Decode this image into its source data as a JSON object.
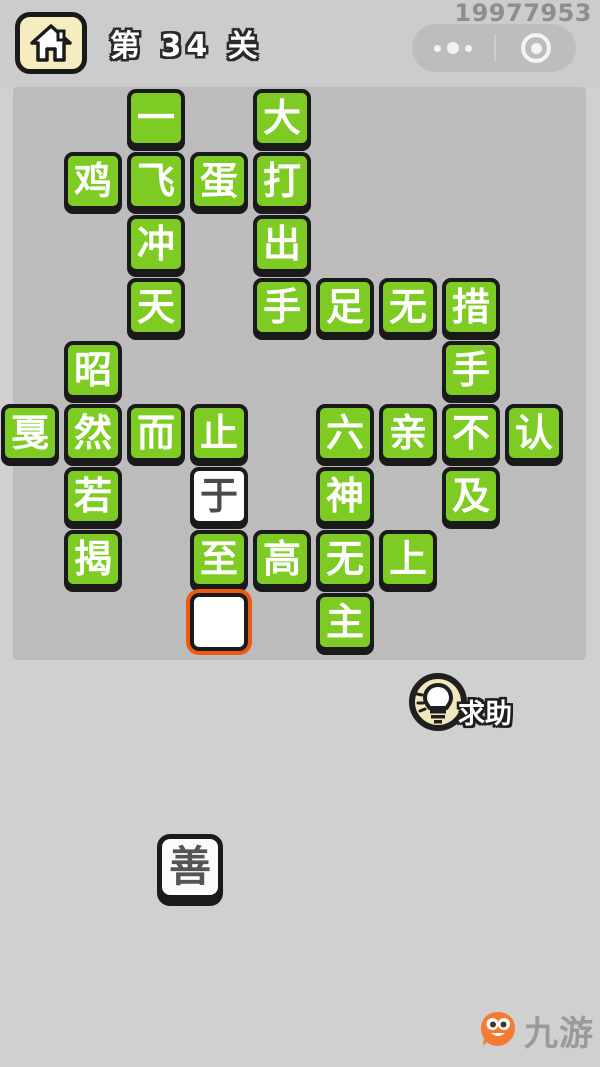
{
  "header": {
    "home_icon": "home-icon",
    "level_text": "第 34 关",
    "score": "19977953",
    "capsule": {
      "menu_icon": "more-dots-icon",
      "target_icon": "target-circle-icon"
    }
  },
  "board": {
    "columns": 8,
    "rows": 9,
    "tiles": [
      {
        "text": "一",
        "col": 1,
        "row": 0,
        "state": "filled"
      },
      {
        "text": "大",
        "col": 3,
        "row": 0,
        "state": "filled"
      },
      {
        "text": "鸡",
        "col": 0,
        "row": 1,
        "state": "filled"
      },
      {
        "text": "飞",
        "col": 1,
        "row": 1,
        "state": "filled"
      },
      {
        "text": "蛋",
        "col": 2,
        "row": 1,
        "state": "filled"
      },
      {
        "text": "打",
        "col": 3,
        "row": 1,
        "state": "filled"
      },
      {
        "text": "冲",
        "col": 1,
        "row": 2,
        "state": "filled"
      },
      {
        "text": "出",
        "col": 3,
        "row": 2,
        "state": "filled"
      },
      {
        "text": "天",
        "col": 1,
        "row": 3,
        "state": "filled"
      },
      {
        "text": "手",
        "col": 3,
        "row": 3,
        "state": "filled"
      },
      {
        "text": "足",
        "col": 4,
        "row": 3,
        "state": "filled"
      },
      {
        "text": "无",
        "col": 5,
        "row": 3,
        "state": "filled"
      },
      {
        "text": "措",
        "col": 6,
        "row": 3,
        "state": "filled"
      },
      {
        "text": "昭",
        "col": 0,
        "row": 4,
        "state": "filled"
      },
      {
        "text": "手",
        "col": 6,
        "row": 4,
        "state": "filled"
      },
      {
        "text": "戛",
        "col": -1,
        "row": 5,
        "state": "filled"
      },
      {
        "text": "然",
        "col": 0,
        "row": 5,
        "state": "filled"
      },
      {
        "text": "而",
        "col": 1,
        "row": 5,
        "state": "filled"
      },
      {
        "text": "止",
        "col": 2,
        "row": 5,
        "state": "filled"
      },
      {
        "text": "六",
        "col": 4,
        "row": 5,
        "state": "filled"
      },
      {
        "text": "亲",
        "col": 5,
        "row": 5,
        "state": "filled"
      },
      {
        "text": "不",
        "col": 6,
        "row": 5,
        "state": "filled"
      },
      {
        "text": "认",
        "col": 7,
        "row": 5,
        "state": "filled"
      },
      {
        "text": "若",
        "col": 0,
        "row": 6,
        "state": "filled"
      },
      {
        "text": "于",
        "col": 2,
        "row": 6,
        "state": "blank"
      },
      {
        "text": "神",
        "col": 4,
        "row": 6,
        "state": "filled"
      },
      {
        "text": "及",
        "col": 6,
        "row": 6,
        "state": "filled"
      },
      {
        "text": "揭",
        "col": 0,
        "row": 7,
        "state": "filled"
      },
      {
        "text": "至",
        "col": 2,
        "row": 7,
        "state": "filled"
      },
      {
        "text": "高",
        "col": 3,
        "row": 7,
        "state": "filled"
      },
      {
        "text": "无",
        "col": 4,
        "row": 7,
        "state": "filled"
      },
      {
        "text": "上",
        "col": 5,
        "row": 7,
        "state": "filled"
      },
      {
        "text": "",
        "col": 2,
        "row": 8,
        "state": "selected"
      },
      {
        "text": "主",
        "col": 4,
        "row": 8,
        "state": "filled"
      }
    ]
  },
  "help": {
    "label": "求助",
    "icon": "lightbulb-icon"
  },
  "answer_tray": {
    "tiles": [
      {
        "text": "善"
      }
    ]
  },
  "watermark": {
    "text": "九游",
    "icon": "jiuyou-mascot-icon"
  },
  "colors": {
    "tile_green": "#7ecb24",
    "tile_outline": "#1a1a1a",
    "selected_outline": "#ef5a12",
    "board_bg": "#bcbcbc",
    "page_bg": "#d0d0d0",
    "home_fill": "#f7ecc0",
    "mascot_orange": "#f47b33"
  }
}
